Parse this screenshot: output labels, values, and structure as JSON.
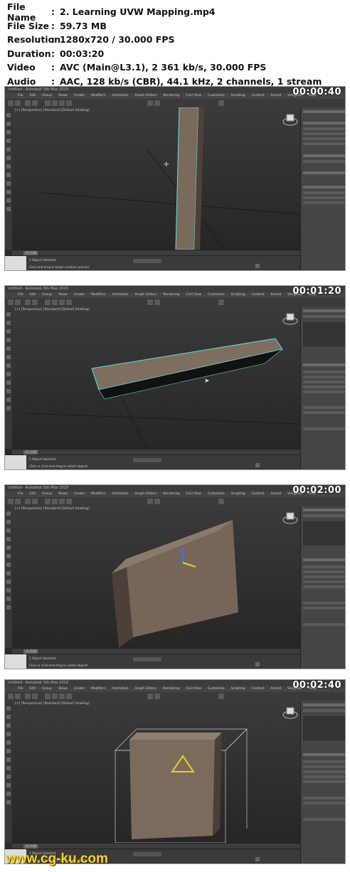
{
  "media_info": [
    {
      "key": "File Name",
      "value": "2. Learning UVW Mapping.mp4"
    },
    {
      "key": "File Size",
      "value": "59.73 MB"
    },
    {
      "key": "Resolution",
      "value": "1280x720 / 30.000 FPS"
    },
    {
      "key": "Duration",
      "value": "00:03:20"
    },
    {
      "key": "Video",
      "value": "AVC (Main@L3.1), 2 361 kb/s, 30.000 FPS"
    },
    {
      "key": "Audio",
      "value": "AAC, 128 kb/s (CBR), 44.1 kHz, 2 channels, 1 stream"
    }
  ],
  "separator": ":",
  "app": {
    "title": "Untitled - Autodesk 3ds Max 2019",
    "menu": [
      "File",
      "Edit",
      "Group",
      "Views",
      "Create",
      "Modifiers",
      "Animation",
      "Graph Editors",
      "Rendering",
      "Civil View",
      "Customize",
      "Scripting",
      "Content",
      "Arnold",
      "Vierge3D",
      "Help"
    ],
    "viewport_label": "[+] [Perspective] [Standard] [Default Shading]",
    "timeline_frame": "0 / 100",
    "grid": "Grid = 10.0cm",
    "add_time_tag": "Add Time Tag",
    "selected": "Selected"
  },
  "frames": [
    {
      "timestamp": "00:00:40",
      "status_selected": "1 Object Selected",
      "status_hint": "Click and drag to begin creation process"
    },
    {
      "timestamp": "00:01:20",
      "status_selected": "1 Object Selected",
      "status_hint": "Click or click-and-drag to select objects"
    },
    {
      "timestamp": "00:02:00",
      "status_selected": "1 Object Selected",
      "status_hint": "Click or click-and-drag to select objects"
    },
    {
      "timestamp": "00:02:40",
      "status_selected": "1 Object Selected",
      "status_hint": "Click or click-and-drag to select objects"
    }
  ],
  "watermark": "www.cg-ku.com",
  "colors": {
    "watermark": "#ffd21a",
    "viewport": "#2b2b2b",
    "selection": "#5fe0e0"
  }
}
